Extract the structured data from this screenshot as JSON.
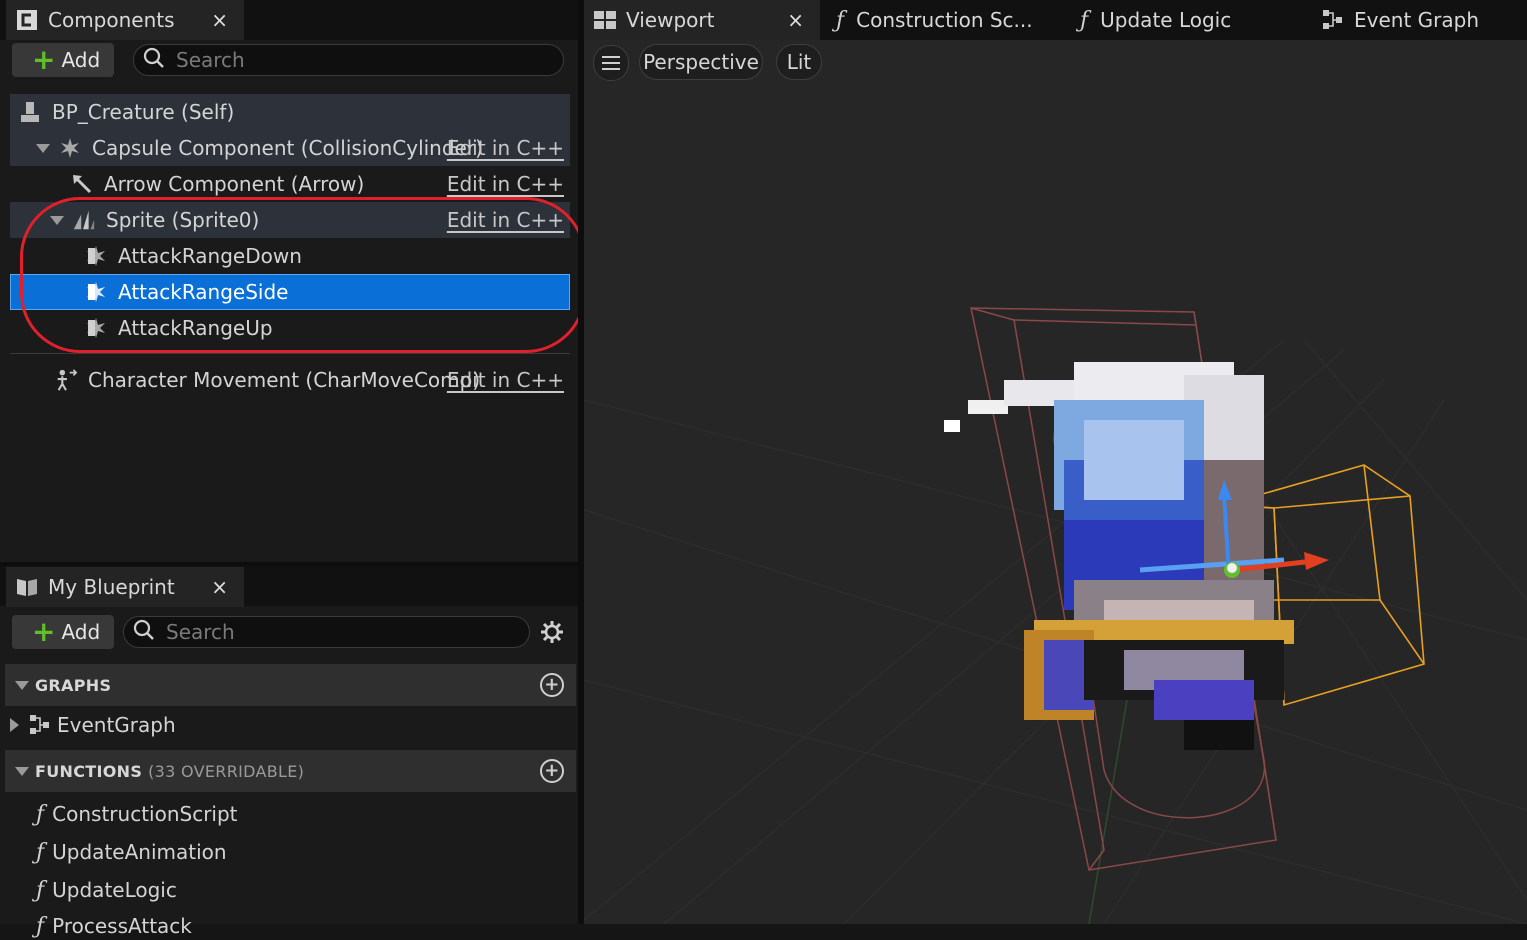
{
  "components_panel": {
    "tab_title": "Components",
    "add_label": "Add",
    "search_placeholder": "Search",
    "tree": [
      {
        "label": "BP_Creature (Self)",
        "edit": ""
      },
      {
        "label": "Capsule Component (CollisionCylinder)",
        "edit": "Edit in C++"
      },
      {
        "label": "Arrow Component (Arrow)",
        "edit": "Edit in C++"
      },
      {
        "label": "Sprite (Sprite0)",
        "edit": "Edit in C++"
      },
      {
        "label": "AttackRangeDown",
        "edit": ""
      },
      {
        "label": "AttackRangeSide",
        "edit": ""
      },
      {
        "label": "AttackRangeUp",
        "edit": ""
      },
      {
        "label": "Character Movement (CharMoveComp)",
        "edit": "Edit in C++"
      }
    ],
    "selected": "AttackRangeSide"
  },
  "my_blueprint": {
    "tab_title": "My Blueprint",
    "add_label": "Add",
    "search_placeholder": "Search",
    "graphs_header": "GRAPHS",
    "graph_items": [
      "EventGraph"
    ],
    "functions_header": "FUNCTIONS",
    "functions_count": "(33 OVERRIDABLE)",
    "function_items": [
      "ConstructionScript",
      "UpdateAnimation",
      "UpdateLogic",
      "ProcessAttack"
    ]
  },
  "editor_tabs": [
    {
      "label": "Viewport",
      "icon": "viewport-icon"
    },
    {
      "label": "Construction Sc...",
      "icon": "function-icon"
    },
    {
      "label": "Update Logic",
      "icon": "function-icon"
    },
    {
      "label": "Event Graph",
      "icon": "graph-icon"
    }
  ],
  "viewport": {
    "view_mode": "Perspective",
    "lighting": "Lit"
  },
  "colors": {
    "selection": "#0a6fd6",
    "highlight_ring": "#e0202a",
    "collision_box": "#e8a020",
    "capsule_wire": "#8a4848"
  }
}
